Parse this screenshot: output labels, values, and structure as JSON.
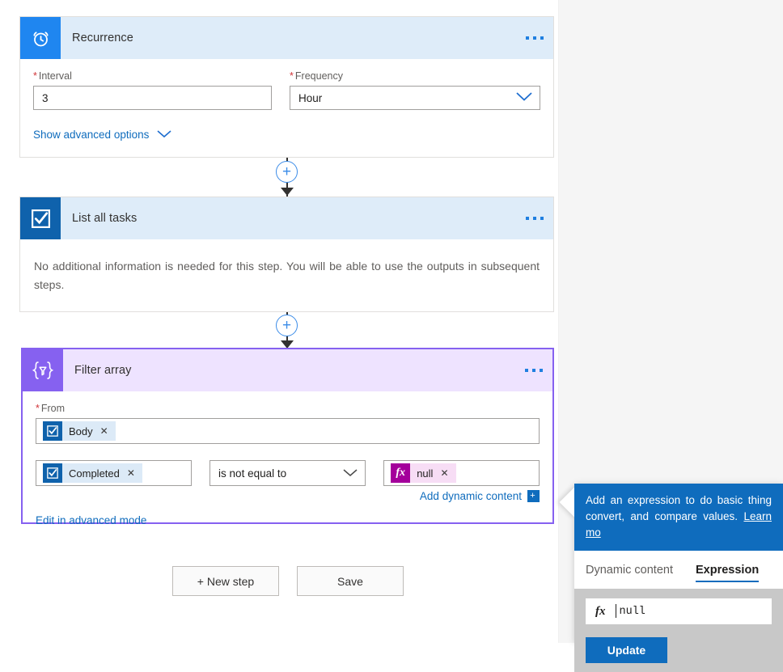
{
  "cards": {
    "recurrence": {
      "title": "Recurrence",
      "icon": "alarm-clock-icon",
      "interval_label": "Interval",
      "interval_value": "3",
      "frequency_label": "Frequency",
      "frequency_value": "Hour",
      "advanced_link": "Show advanced options",
      "required_marker": "*"
    },
    "list_tasks": {
      "title": "List all tasks",
      "icon": "checkbox-icon",
      "info": "No additional information is needed for this step. You will be able to use the outputs in subsequent steps."
    },
    "filter_array": {
      "title": "Filter array",
      "icon": "filter-braces-icon",
      "from_label": "From",
      "from_token": "Body",
      "left_token": "Completed",
      "operator": "is not equal to",
      "right_token": "null",
      "add_dynamic_content": "Add dynamic content",
      "advanced_link": "Edit in advanced mode",
      "required_marker": "*",
      "remove_glyph": "✕"
    }
  },
  "toolbar": {
    "new_step_label": "+ New step",
    "save_label": "Save"
  },
  "flyout": {
    "banner_text": "Add an expression to do basic thing convert, and compare values. ",
    "banner_link": "Learn mo",
    "tab_dynamic": "Dynamic content",
    "tab_expression": "Expression",
    "expression_value": "null",
    "fx_glyph": "fx",
    "update_label": "Update"
  },
  "colors": {
    "accent_blue": "#0f6cbd",
    "recurrence_icon": "#1f86f0",
    "tasks_icon": "#0f62ac",
    "filter_icon": "#8661f0",
    "filter_header": "#eee3ff",
    "step_header": "#deecf9",
    "token_pink": "#a4009b"
  }
}
